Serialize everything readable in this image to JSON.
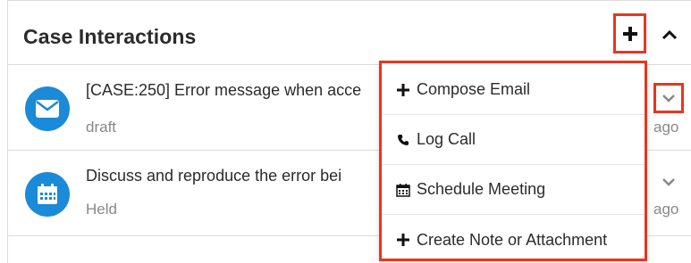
{
  "panel": {
    "title": "Case Interactions"
  },
  "records": [
    {
      "title": "[CASE:250] Error message when acce",
      "status": "draft",
      "age": "ago",
      "icon": "envelope-icon"
    },
    {
      "title": "Discuss and reproduce the error bei",
      "status": "Held",
      "age": "ago",
      "icon": "calendar-icon"
    }
  ],
  "menu": {
    "items": [
      {
        "label": "Compose Email",
        "icon": "plus-icon"
      },
      {
        "label": "Log Call",
        "icon": "phone-icon"
      },
      {
        "label": "Schedule Meeting",
        "icon": "calendar-icon"
      },
      {
        "label": "Create Note or Attachment",
        "icon": "plus-icon"
      }
    ]
  },
  "colors": {
    "accent": "#1b8ad8",
    "highlight": "#e8361d",
    "text": "#2b2b2b",
    "muted": "#888888"
  }
}
